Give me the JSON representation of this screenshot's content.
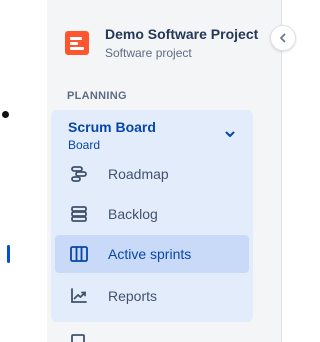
{
  "project": {
    "name": "Demo Software Project",
    "type": "Software project",
    "avatar_color": "#ff5630"
  },
  "section": {
    "heading": "PLANNING"
  },
  "board": {
    "name": "Scrum Board",
    "type": "Board",
    "chevron_icon": "chevron-down-icon"
  },
  "nav": {
    "items": [
      {
        "label": "Roadmap",
        "icon": "roadmap-icon",
        "active": false
      },
      {
        "label": "Backlog",
        "icon": "backlog-icon",
        "active": false
      },
      {
        "label": "Active sprints",
        "icon": "board-columns-icon",
        "active": true
      },
      {
        "label": "Reports",
        "icon": "reports-icon",
        "active": false
      }
    ]
  },
  "colors": {
    "sidebar_bg": "#f4f5f7",
    "board_bg": "#e3ecfb",
    "active_bg": "#c9d9f8",
    "accent": "#0052cc",
    "board_text": "#0747a6"
  },
  "collapse_button_icon": "chevron-left-icon"
}
